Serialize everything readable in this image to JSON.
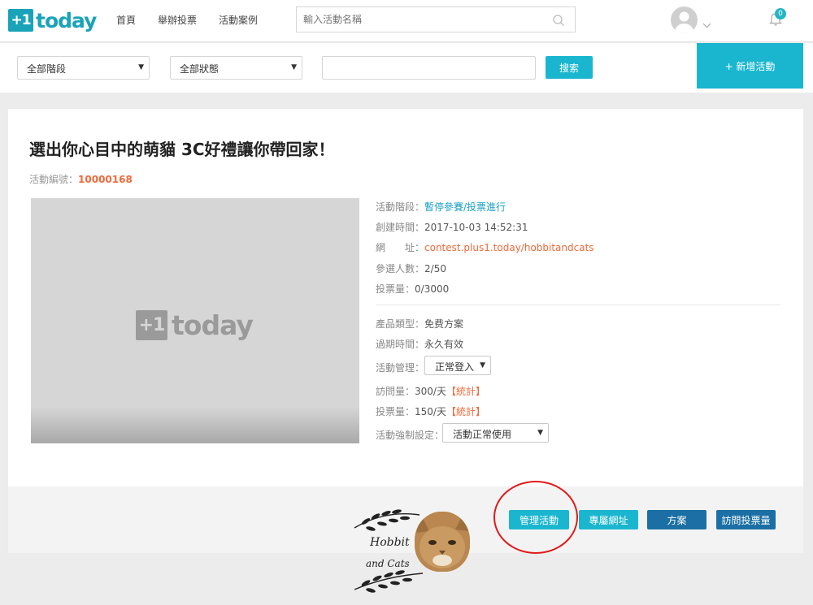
{
  "nav": {
    "logo_box": "+1",
    "logo_word": "today",
    "links": [
      "首頁",
      "舉辦投票",
      "活動案例"
    ],
    "search_placeholder": "輸入活動名稱",
    "notification_count": "0"
  },
  "filters": {
    "stage_select": "全部階段",
    "status_select": "全部狀態",
    "keyword_value": "",
    "search_label": "搜索",
    "new_event_label": "+ 新增活動"
  },
  "event": {
    "title": "選出你心目中的萌貓 3C好禮讓你帶回家！",
    "id_label": "活動編號：",
    "id_value": "10000168",
    "cover_logo_box": "+1",
    "cover_logo_word": "today",
    "stage_label": "活動階段：",
    "stage_value": "暫停參賽/投票進行",
    "created_label": "創建時間：",
    "created_value": "2017-10-03 14:52:31",
    "url_label": "網　　址：",
    "url_value": "contest.plus1.today/hobbitandcats",
    "participants_label": "參選人數：",
    "participants_value": "2/50",
    "votes_label": "投票量：",
    "votes_value": "0/3000",
    "product_label": "產品類型：",
    "product_value": "免费方案",
    "expiry_label": "過期時間：",
    "expiry_value": "永久有效",
    "manage_label": "活動管理：",
    "manage_select": "正常登入",
    "visits_label": "訪問量：",
    "visits_value": "300/天",
    "stats_link": "【統計】",
    "daily_votes_label": "投票量：",
    "daily_votes_value": "150/天",
    "force_label": "活動強制設定：",
    "force_select": "活動正常使用"
  },
  "actions": {
    "manage": "管理活動",
    "url": "專屬網址",
    "plan": "方案",
    "visits": "訪問投票量"
  },
  "branding": {
    "line1": "Hobbit",
    "line2": "and Cats"
  },
  "colors": {
    "brand": "#1aa3b8",
    "accent": "#1ab6cf",
    "dark_button": "#1b6fa4",
    "highlight": "#ef6a3b",
    "annotation": "#e01a1a"
  }
}
